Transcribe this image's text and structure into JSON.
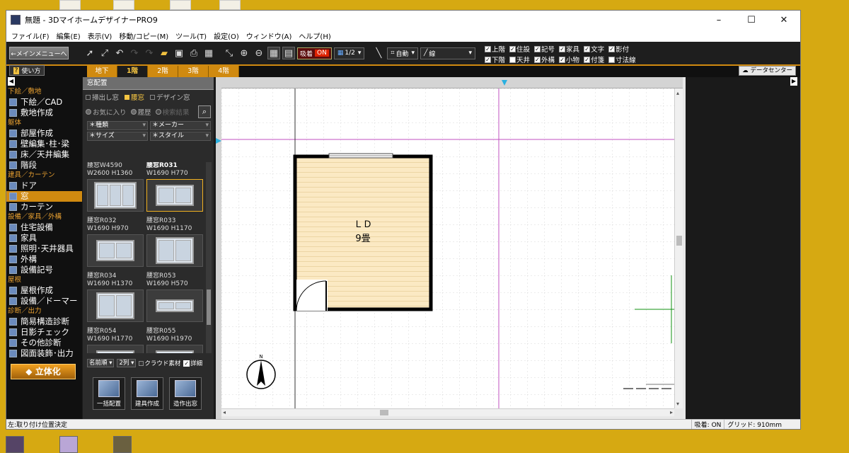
{
  "window": {
    "title": "無題 - 3DマイホームデザイナーPRO9",
    "minimize": "–",
    "maximize": "☐",
    "close": "✕"
  },
  "menubar": [
    "ファイル(F)",
    "編集(E)",
    "表示(V)",
    "移動/コピー(M)",
    "ツール(T)",
    "設定(O)",
    "ウィンドウ(A)",
    "ヘルプ(H)"
  ],
  "toolbar": {
    "main_menu": "←メインメニューへ",
    "snap_label": "吸着",
    "snap_state": "ON",
    "grid_ratio": "1/2",
    "auto_label": "自動",
    "line_label": "線",
    "checks": [
      {
        "label": "上階",
        "checked": true
      },
      {
        "label": "住設",
        "checked": true
      },
      {
        "label": "記号",
        "checked": true
      },
      {
        "label": "家具",
        "checked": true
      },
      {
        "label": "文字",
        "checked": true
      },
      {
        "label": "影付",
        "checked": true
      },
      {
        "label": "",
        "checked": false
      },
      {
        "label": "下階",
        "checked": true
      },
      {
        "label": "天井",
        "checked": false
      },
      {
        "label": "外構",
        "checked": true
      },
      {
        "label": "小物",
        "checked": true
      },
      {
        "label": "付箋",
        "checked": true
      },
      {
        "label": "寸法線",
        "checked": false
      },
      {
        "label": "",
        "checked": false
      }
    ]
  },
  "tabrow": {
    "help": "使い方",
    "floors": [
      "地下",
      "1階",
      "2階",
      "3階",
      "4階"
    ],
    "active_floor": "1階",
    "datacenter": "データセンター"
  },
  "sidebar": {
    "sections": [
      {
        "category": "下絵／敷地",
        "items": [
          "下絵／CAD",
          "敷地作成"
        ]
      },
      {
        "category": "躯体",
        "items": [
          "部屋作成",
          "壁編集･柱･梁",
          "床／天井編集",
          "階段"
        ]
      },
      {
        "category": "建具／カーテン",
        "items": [
          "ドア",
          "窓",
          "カーテン"
        ]
      },
      {
        "category": "設備／家具／外構",
        "items": [
          "住宅設備",
          "家具",
          "照明･天井器具",
          "外構",
          "設備記号"
        ]
      },
      {
        "category": "屋根",
        "items": [
          "屋根作成",
          "設備／ドーマー"
        ]
      },
      {
        "category": "診断／出力",
        "items": [
          "簡易構造診断",
          "日影チェック",
          "その他診断",
          "図面装飾･出力"
        ]
      }
    ],
    "active_item": "窓",
    "button_3d": "立体化"
  },
  "panel": {
    "title": "窓配置",
    "tabs": [
      "掃出し窓",
      "腰窓",
      "デザイン窓"
    ],
    "active_tab": "腰窓",
    "radios": [
      "お気に入り",
      "履歴",
      "検索結果"
    ],
    "filters": [
      "＊種類",
      "＊メーカー",
      "＊サイズ",
      "＊スタイル"
    ],
    "cards": [
      {
        "name": "腰窓W4590",
        "size": "W2600 H1360",
        "selected": false,
        "panes": 3
      },
      {
        "name": "腰窓R031",
        "size": "W1690 H770",
        "selected": true,
        "panes": 2
      },
      {
        "name": "腰窓R032",
        "size": "W1690 H970",
        "selected": false,
        "panes": 2
      },
      {
        "name": "腰窓R033",
        "size": "W1690 H1170",
        "selected": false,
        "panes": 2
      },
      {
        "name": "腰窓R034",
        "size": "W1690 H1370",
        "selected": false,
        "panes": 2
      },
      {
        "name": "腰窓R053",
        "size": "W1690 H570",
        "selected": false,
        "panes": 2
      },
      {
        "name": "腰窓R054",
        "size": "W1690 H1770",
        "selected": false,
        "panes": 2
      },
      {
        "name": "腰窓R055",
        "size": "W1690 H1970",
        "selected": false,
        "panes": 2
      }
    ],
    "sort": "名前順",
    "columns": "2列",
    "cloud_label": "クラウド素材",
    "detail_label": "詳細",
    "actions": [
      "一括配置",
      "建具作成",
      "造作出窓"
    ]
  },
  "plan": {
    "room_name": "ＬＤ",
    "room_size": "9畳",
    "north": "N"
  },
  "status": {
    "left": "左:取り付け位置決定",
    "snap": "吸着: ON",
    "grid": "グリッド: 910mm"
  }
}
